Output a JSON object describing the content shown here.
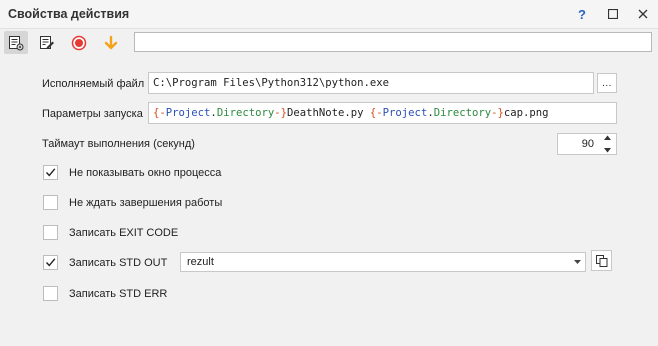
{
  "window": {
    "title": "Свойства действия",
    "help_label": "?"
  },
  "toolbar": {
    "input_value": "",
    "icons": [
      "properties-icon",
      "edit-note-icon",
      "record-icon",
      "download-arrow-icon"
    ]
  },
  "form": {
    "exec_file": {
      "label": "Исполняемый файл",
      "value": "C:\\Program Files\\Python312\\python.exe",
      "browse_label": "..."
    },
    "launch_params": {
      "label": "Параметры запуска",
      "tokens": {
        "open1": "{-",
        "ns1": "Project",
        "dot1": ".",
        "prop1": "Directory",
        "close1": "-}",
        "text1": "DeathNote.py ",
        "open2": "{-",
        "ns2": "Project",
        "dot2": ".",
        "prop2": "Directory",
        "close2": "-}",
        "text2": "cap.png"
      }
    },
    "timeout": {
      "label": "Таймаут выполнения (секунд)",
      "value": "90"
    },
    "checkboxes": [
      {
        "label": "Не показывать окно процесса",
        "checked": true
      },
      {
        "label": "Не ждать завершения работы",
        "checked": false
      },
      {
        "label": "Записать EXIT CODE",
        "checked": false
      },
      {
        "label": "Записать STD OUT",
        "checked": true
      },
      {
        "label": "Записать STD ERR",
        "checked": false
      }
    ],
    "std_out_variable": "rezult"
  },
  "colors": {
    "accent_blue": "#2a63c6",
    "record_red": "#e53935",
    "arrow_orange": "#f5a21b",
    "token_bracket": "#d94a1e",
    "token_namespace": "#2a4fb8",
    "token_property": "#2b8a3e"
  }
}
